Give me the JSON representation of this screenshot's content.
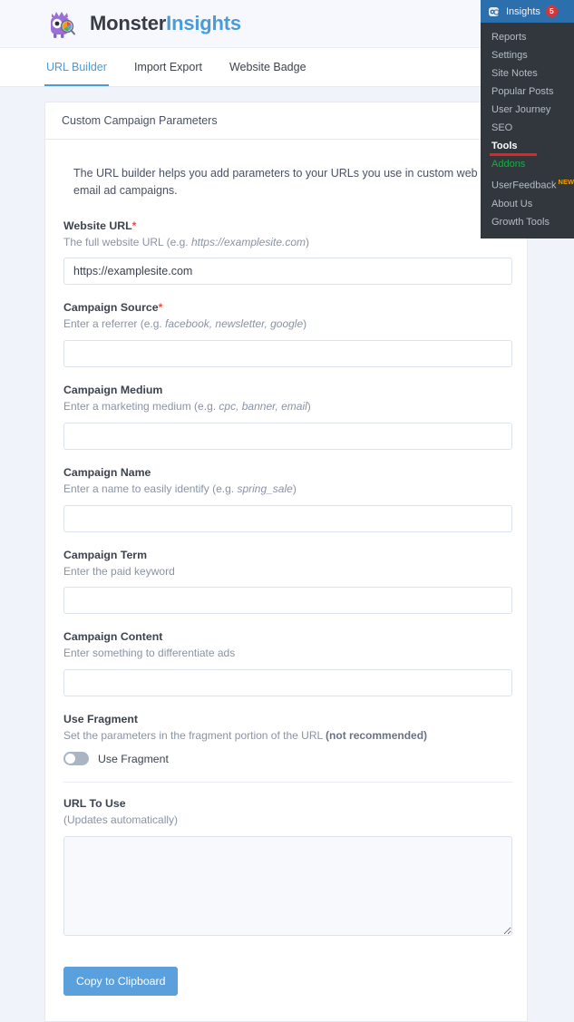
{
  "brand": {
    "name_part1": "Monster",
    "name_part2": "Insights",
    "logo_icon": "monster-logo-icon",
    "accent_color": "#4a9bda",
    "logo_color": "#8a63d2"
  },
  "tabs": [
    {
      "label": "URL Builder",
      "active": true
    },
    {
      "label": "Import Export",
      "active": false
    },
    {
      "label": "Website Badge",
      "active": false
    }
  ],
  "card": {
    "header": "Custom Campaign Parameters",
    "intro": "The URL builder helps you add parameters to your URLs you use in custom web or email ad campaigns."
  },
  "fields": {
    "website_url": {
      "label": "Website URL",
      "required_marker": "*",
      "hint_prefix": "The full website URL (e.g. ",
      "hint_italic": "https://examplesite.com",
      "hint_suffix": ")",
      "value": "https://examplesite.com",
      "placeholder": ""
    },
    "campaign_source": {
      "label": "Campaign Source",
      "required_marker": "*",
      "hint_prefix": "Enter a referrer (e.g. ",
      "hint_italic": "facebook, newsletter, google",
      "hint_suffix": ")",
      "value": "",
      "placeholder": ""
    },
    "campaign_medium": {
      "label": "Campaign Medium",
      "required_marker": "",
      "hint_prefix": "Enter a marketing medium (e.g. ",
      "hint_italic": "cpc, banner, email",
      "hint_suffix": ")",
      "value": "",
      "placeholder": ""
    },
    "campaign_name": {
      "label": "Campaign Name",
      "required_marker": "",
      "hint_prefix": "Enter a name to easily identify (e.g. ",
      "hint_italic": "spring_sale",
      "hint_suffix": ")",
      "value": "",
      "placeholder": ""
    },
    "campaign_term": {
      "label": "Campaign Term",
      "required_marker": "",
      "hint_prefix": "Enter the paid keyword",
      "hint_italic": "",
      "hint_suffix": "",
      "value": "",
      "placeholder": ""
    },
    "campaign_content": {
      "label": "Campaign Content",
      "required_marker": "",
      "hint_prefix": "Enter something to differentiate ads",
      "hint_italic": "",
      "hint_suffix": "",
      "value": "",
      "placeholder": ""
    },
    "use_fragment": {
      "label": "Use Fragment",
      "hint_prefix": "Set the parameters in the fragment portion of the URL ",
      "hint_bold": "(not recommended)",
      "toggle_label": "Use Fragment",
      "toggle_state": "off"
    },
    "url_to_use": {
      "label": "URL To Use",
      "hint_prefix": "(Updates automatically)",
      "value": "",
      "placeholder": ""
    }
  },
  "actions": {
    "copy_button": "Copy to Clipboard"
  },
  "admin_menu": {
    "header_label": "Insights",
    "header_icon": "monster-head-icon",
    "badge_count": "5",
    "header_color": "#2c6fad",
    "background_color": "#32373d",
    "items": [
      {
        "label": "Reports",
        "style": "normal"
      },
      {
        "label": "Settings",
        "style": "normal"
      },
      {
        "label": "Site Notes",
        "style": "normal"
      },
      {
        "label": "Popular Posts",
        "style": "normal"
      },
      {
        "label": "User Journey",
        "style": "normal"
      },
      {
        "label": "SEO",
        "style": "normal"
      },
      {
        "label": "Tools",
        "style": "highlight"
      },
      {
        "label": "Addons",
        "style": "addon"
      },
      {
        "label": "UserFeedback",
        "style": "normal",
        "tag": "NEW"
      },
      {
        "label": "About Us",
        "style": "normal"
      },
      {
        "label": "Growth Tools",
        "style": "normal"
      }
    ]
  }
}
